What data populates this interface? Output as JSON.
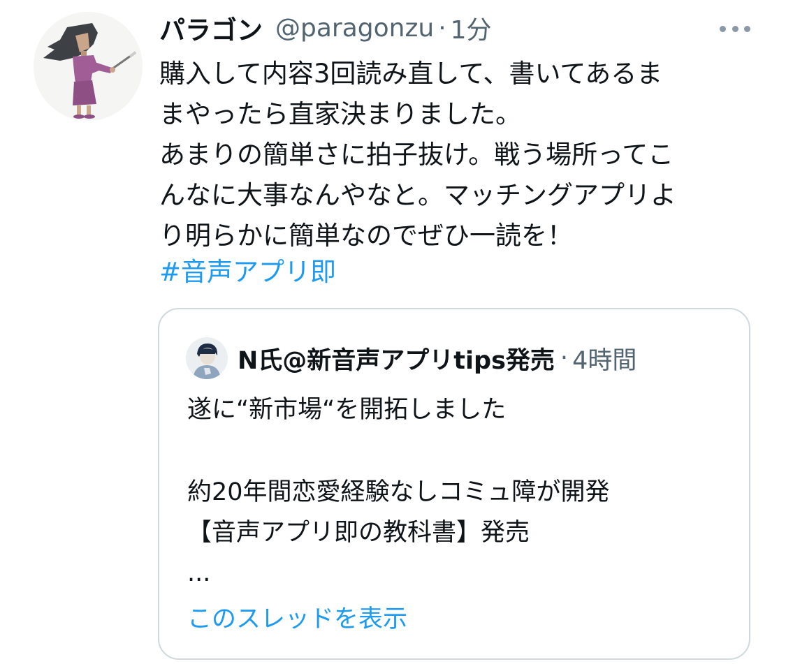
{
  "tweet": {
    "author": {
      "display_name": "パラゴン",
      "handle": "@paragonzu",
      "avatar_icon": "user-avatar-illustration-icon"
    },
    "separator": "·",
    "time": "1分",
    "more_icon": "more-horizontal-icon",
    "text_lines": [
      "購入して内容3回読み直して、書いてあるま",
      "まやったら直家決まりました。",
      "あまりの簡単さに拍子抜け。戦う場所ってこ",
      "んなに大事なんやなと。マッチングアプリよ",
      "り明らかに簡単なのでぜひ一読を！"
    ],
    "hashtag": "#音声アプリ即",
    "colors": {
      "link": "#1d9bf0",
      "secondary_text": "#536471",
      "border": "#cfd9de"
    }
  },
  "quoted_tweet": {
    "author": {
      "display_name": "N氏@新音声アプリtips発売",
      "avatar_icon": "user-avatar-illustration-icon"
    },
    "separator": "·",
    "time": "4時間",
    "text_lines": [
      "遂に“新市場“を開拓しました",
      "",
      "約20年間恋愛経験なしコミュ障が開発",
      "【音声アプリ即の教科書】発売",
      "..."
    ],
    "show_thread_label": "このスレッドを表示"
  }
}
